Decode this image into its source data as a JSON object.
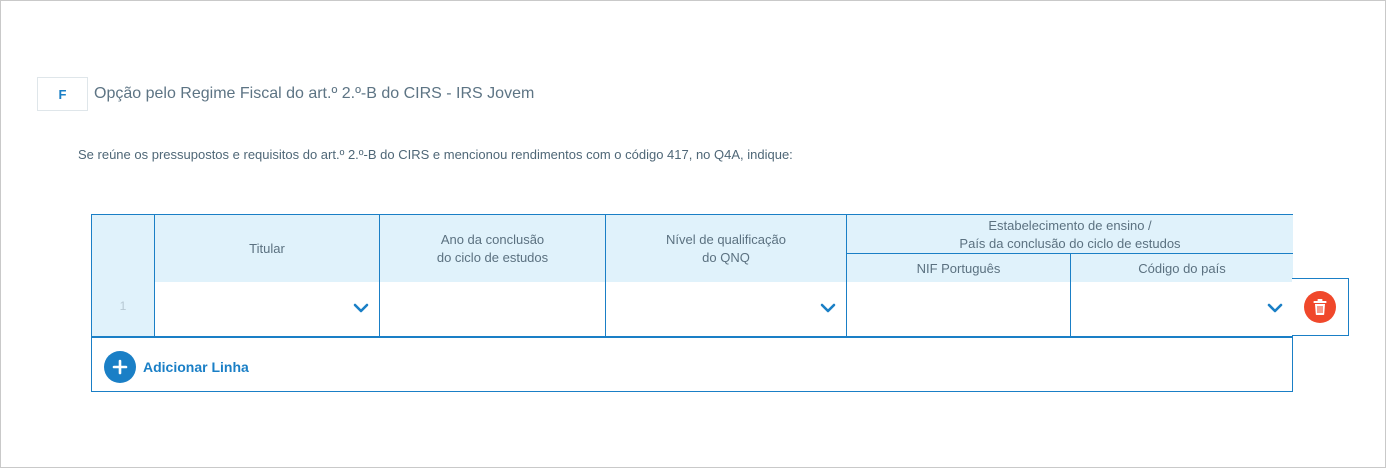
{
  "section": {
    "letter": "F",
    "title": "Opção pelo Regime Fiscal do art.º 2.º-B do CIRS - IRS Jovem"
  },
  "instruction": "Se reúne os pressupostos e requisitos do art.º 2.º-B do CIRS e mencionou rendimentos com o código 417, no Q4A, indique:",
  "table": {
    "headers": {
      "titular": "Titular",
      "ano_line1": "Ano da conclusão",
      "ano_line2": "do ciclo de estudos",
      "nivel_line1": "Nível de qualificação",
      "nivel_line2": "do QNQ",
      "estab_line1": "Estabelecimento de ensino /",
      "estab_line2": "País da conclusão do ciclo de estudos",
      "nif": "NIF Português",
      "codigo_pais": "Código do país"
    },
    "rows": [
      {
        "number": "1",
        "titular": "",
        "ano": "",
        "nivel": "",
        "nif": "",
        "codigo_pais": ""
      }
    ]
  },
  "actions": {
    "add_line_label": "Adicionar Linha",
    "add_icon": "plus-icon",
    "delete_icon": "trash-icon"
  },
  "colors": {
    "accent": "#1a7fc6",
    "header_bg": "#e0f2fb",
    "delete": "#f0482b"
  }
}
